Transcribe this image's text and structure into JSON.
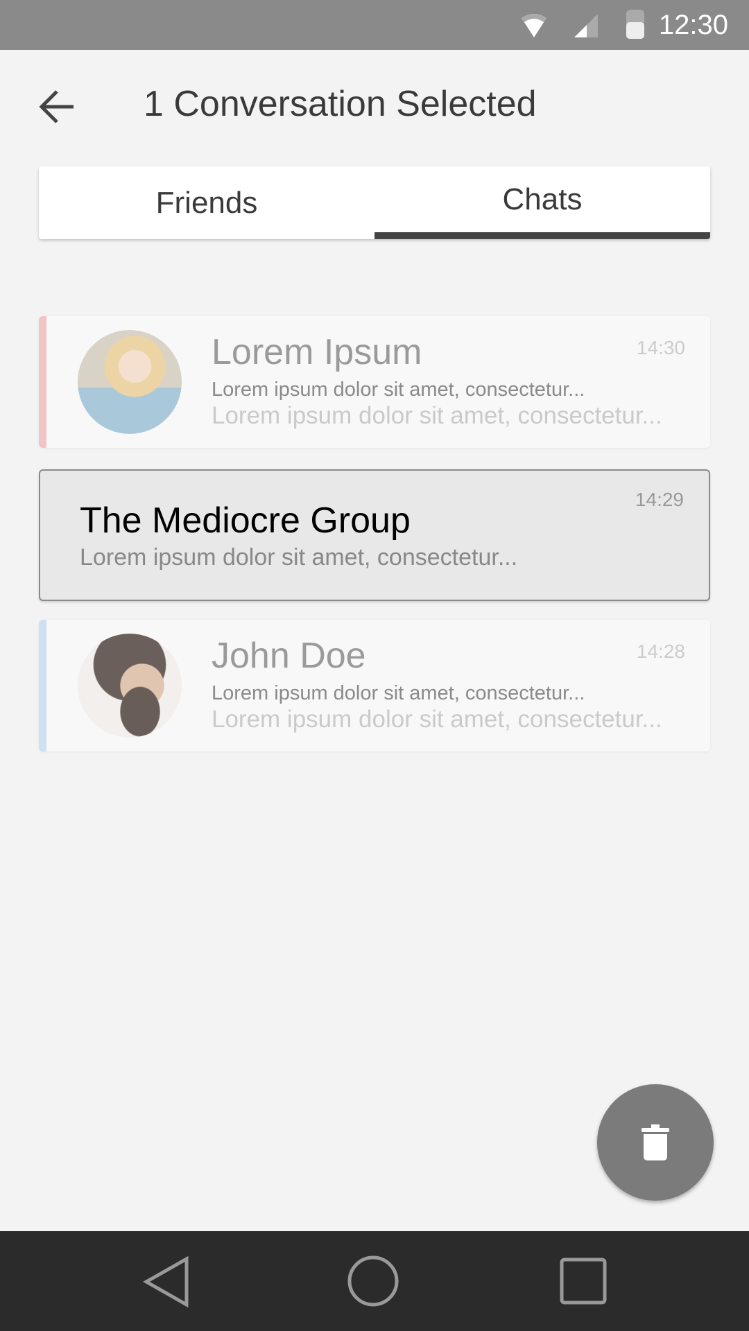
{
  "status_bar": {
    "time": "12:30",
    "icons": [
      "wifi-icon",
      "signal-icon",
      "battery-icon"
    ]
  },
  "header": {
    "title": "1 Conversation Selected",
    "back_icon": "arrow-left-icon"
  },
  "tabs": [
    {
      "label": "Friends",
      "active": false
    },
    {
      "label": "Chats",
      "active": true
    }
  ],
  "conversations": [
    {
      "name": "Lorem Ipsum",
      "line1": "Lorem ipsum dolor sit amet, consectetur...",
      "line2": "Lorem ipsum dolor sit amet, consectetur...",
      "time": "14:30",
      "accent": "#f2c4c8",
      "selected": false
    },
    {
      "name": "The Mediocre Group",
      "line1": "Lorem ipsum dolor sit amet, consectetur...",
      "time": "14:29",
      "selected": true
    },
    {
      "name": "John Doe",
      "line1": "Lorem ipsum dolor sit amet, consectetur...",
      "line2": "Lorem ipsum dolor sit amet, consectetur...",
      "time": "14:28",
      "accent": "#cfe0f5",
      "selected": false
    }
  ],
  "fab": {
    "icon": "trash-icon"
  },
  "nav_bar": {
    "icons": [
      "back-triangle-icon",
      "home-circle-icon",
      "recents-square-icon"
    ]
  }
}
